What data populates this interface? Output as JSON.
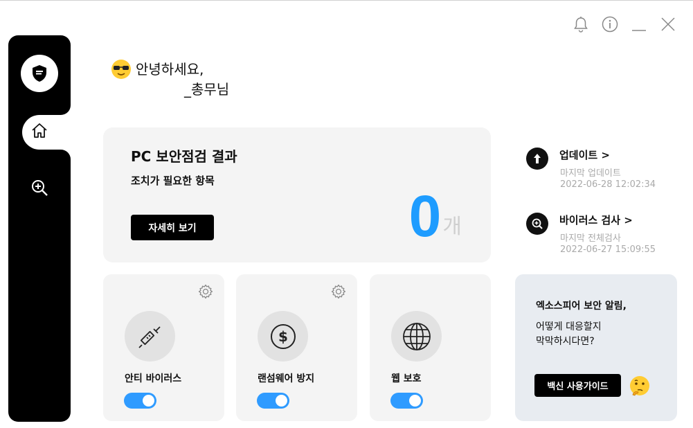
{
  "window": {
    "controls": [
      "bell-icon",
      "info-icon",
      "minimize-icon",
      "close-icon"
    ]
  },
  "sidebar": {
    "logo": "shield-logo",
    "items": [
      {
        "icon": "home-icon",
        "active": true
      },
      {
        "icon": "zoom-scan-icon",
        "active": false
      }
    ]
  },
  "greeting": {
    "hello": "안녕하세요,",
    "name": "_총무님"
  },
  "result": {
    "title": "PC 보안점검 결과",
    "subtitle": "조치가 필요한 항목",
    "detail_button": "자세히 보기",
    "count": "0",
    "unit": "개",
    "accent": "#1e9cff"
  },
  "info": {
    "update": {
      "title": "업데이트 >",
      "label": "마지막 업데이트",
      "date": "2022-06-28 12:02:34"
    },
    "scan": {
      "title": "바이러스 검사 >",
      "label": "마지막 전체검사",
      "date": "2022-06-27 15:09:55"
    }
  },
  "features": [
    {
      "label": "안티 바이러스",
      "icon": "syringe-icon",
      "enabled": true,
      "has_settings": true
    },
    {
      "label": "랜섬웨어 방지",
      "icon": "dollar-icon",
      "enabled": true,
      "has_settings": true
    },
    {
      "label": "웹 보호",
      "icon": "globe-icon",
      "enabled": true,
      "has_settings": false
    }
  ],
  "notice": {
    "title": "엑소스피어 보안 알림,",
    "line1": "어떻게 대응할지",
    "line2": "막막하시다면?",
    "button": "백신 사용가이드"
  },
  "colors": {
    "toggle_on": "#2f9bff",
    "card_bg": "#f4f4f4",
    "notice_bg": "#e8ecf1"
  }
}
